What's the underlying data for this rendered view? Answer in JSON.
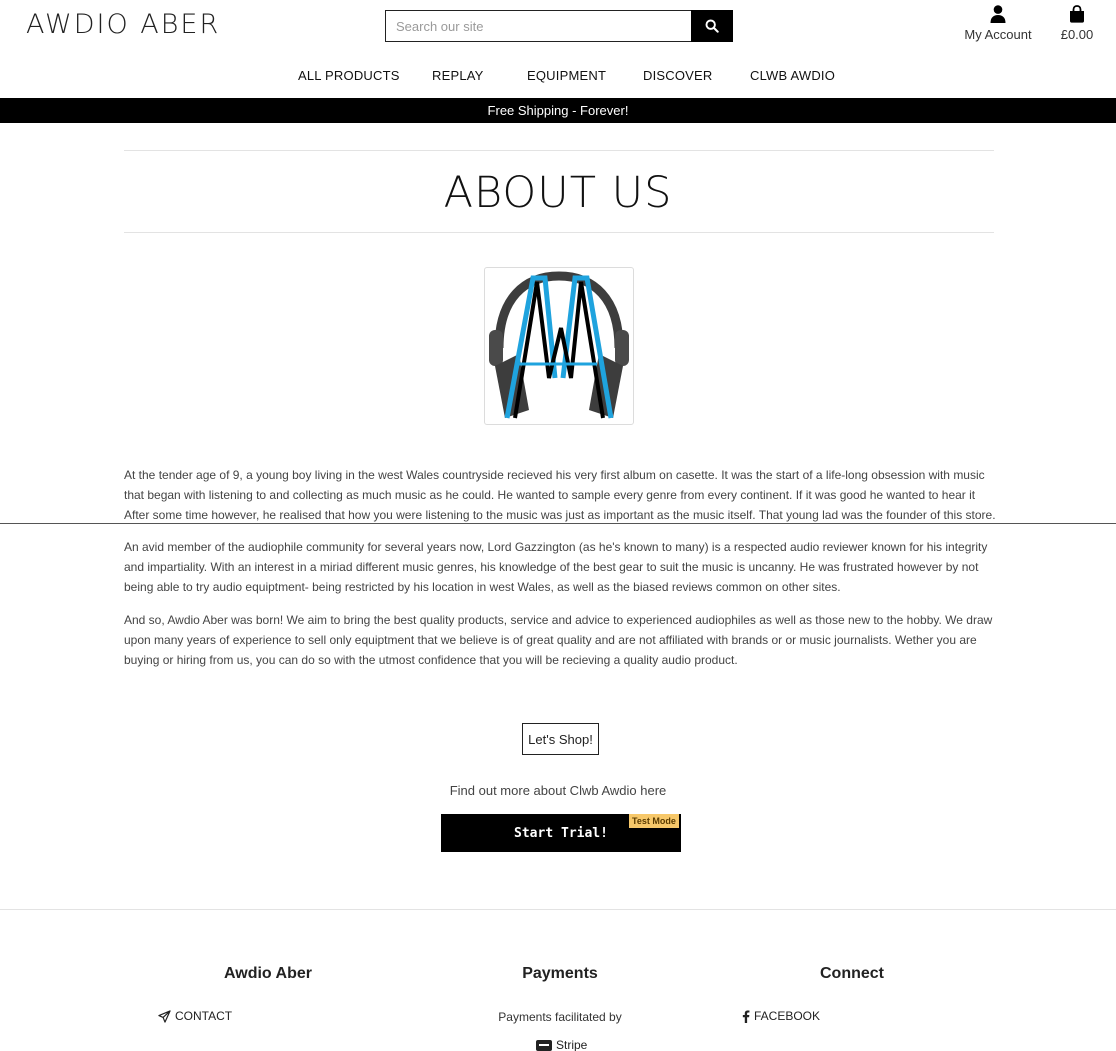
{
  "header": {
    "brand": "AWDIO ABER",
    "search_placeholder": "Search our site",
    "account_label": "My Account",
    "bag_total": "£0.00"
  },
  "nav": {
    "items": [
      "ALL PRODUCTS",
      "REPLAY",
      "EQUIPMENT",
      "DISCOVER",
      "CLWB AWDIO"
    ]
  },
  "banner": {
    "text": "Free Shipping - Forever!"
  },
  "main": {
    "title": "ABOUT US",
    "logo_alt": "AA",
    "paragraphs": [
      "At the tender age of 9, a young boy living in the west Wales countryside recieved his very first album on casette. It was the start of a life-long obsession with music that began with listening to and collecting as much music as he could. He wanted to sample every genre from every continent. If it was good he wanted to hear it After some time however, he realised that how you were listening to the music was just as important as the music itself. That young lad was the founder of this store.",
      "An avid member of the audiophile community for several years now, Lord Gazzington (as he's known to many) is a respected audio reviewer known for his integrity and impartiality. With an interest in a miriad different music genres, his knowledge of the best gear to suit the music is uncanny. He was frustrated however by not being able to try audio equiptment- being restricted by his location in west Wales, as well as the biased reviews common on other sites.",
      "And so, Awdio Aber was born! We aim to bring the best quality products, service and advice to experienced audiophiles as well as those new to the hobby. We draw upon many years of experience to sell only equiptment that we believe is of great quality and are not affiliated with brands or or music journalists. Wether you are buying or hiring from us, you can do so with the utmost confidence that you will be recieving a quality audio product."
    ],
    "shop_button": "Let's Shop!",
    "findout_text": "Find out more about Clwb Awdio here",
    "trial_button": "Start Trial!",
    "test_mode_badge": "Test Mode"
  },
  "footer": {
    "col1_title": "Awdio Aber",
    "col1_link": "CONTACT",
    "col2_title": "Payments",
    "col2_text": "Payments facilitated by",
    "col2_link": "Stripe",
    "col3_title": "Connect",
    "col3_link": "FACEBOOK"
  },
  "colors": {
    "accent": "#000000",
    "logo_blue": "#1fa3de",
    "logo_gray": "#3d3d3d",
    "badge": "#f7c86a"
  }
}
